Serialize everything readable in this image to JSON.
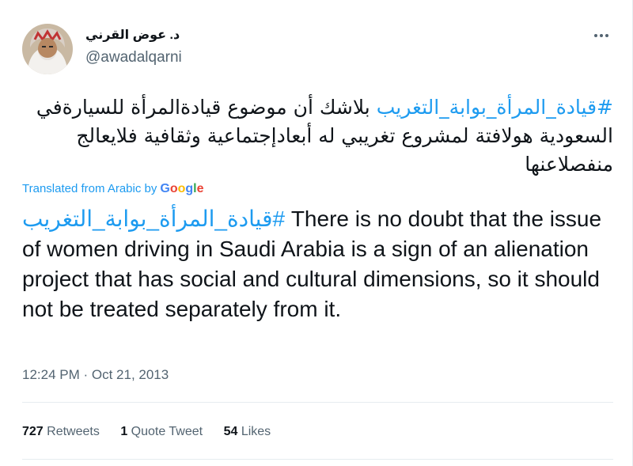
{
  "author": {
    "display_name": "د. عوض القرني",
    "handle": "@awadalqarni"
  },
  "more_icon": "more-horizontal-icon",
  "tweet": {
    "hashtag": "#قيادة_المرأة_بوابة_التغريب",
    "text_line1": " بلاشك أن موضوع قيادةالمرأة للسيارةفي",
    "text_line2": "السعودية هولافتة لمشروع تغريبي له أبعادإجتماعية وثقافية فلايعالج",
    "text_line3": "منفصلاعنها"
  },
  "translation": {
    "label": "Translated from Arabic by",
    "provider_letters": [
      "G",
      "o",
      "o",
      "g",
      "l",
      "e"
    ],
    "provider_colors": [
      "#4285f4",
      "#ea4335",
      "#fbbc05",
      "#4285f4",
      "#34a853",
      "#ea4335"
    ],
    "hashtag": "#قيادة_المرأة_بوابة_التغريب",
    "text": " There is no doubt that the issue of women driving in Saudi Arabia is a sign of an alienation project that has social and cultural dimensions, so it should not be treated separately from it."
  },
  "timestamp": "12:24 PM · Oct 21, 2013",
  "stats": {
    "retweets_count": "727",
    "retweets_label": "Retweets",
    "quotes_count": "1",
    "quotes_label": "Quote Tweet",
    "likes_count": "54",
    "likes_label": "Likes"
  },
  "colors": {
    "accent": "#1d9bf0",
    "text": "#0f1419",
    "secondary": "#536471",
    "divider": "#e6ecf0"
  }
}
